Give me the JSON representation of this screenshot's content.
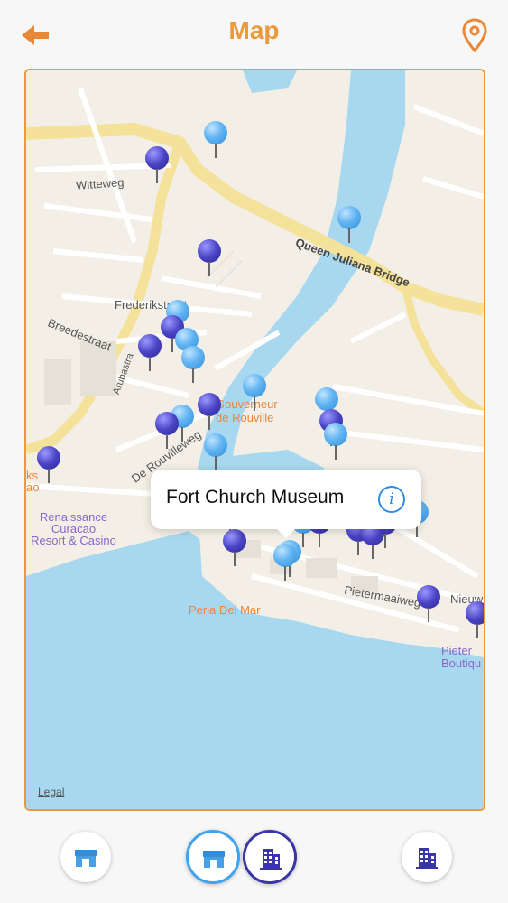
{
  "header": {
    "title": "Map",
    "back_icon": "back-arrow-icon",
    "location_icon": "location-pin-icon",
    "accent": "#e89a3c"
  },
  "map": {
    "streets": {
      "witteweg": "Witteweg",
      "queen_juliana": "Queen Juliana Bridge",
      "frederikstraat": "Frederikstraat",
      "breedestraat": "Breedestraat",
      "arubastraat": "Arubastra",
      "de_rouvilleweg": "De Rouvilleweg",
      "pietermaaiweg": "Pietermaaiweg",
      "nieuw": "Nieuw"
    },
    "pois": {
      "gouverneur": "Gouverneur\nde Rouville",
      "renaissance": "Renaissance\nCuracao\nResort & Casino",
      "peria": "Peria Del Mar",
      "pieter": "Pieter\nBoutiqu",
      "ksao": "ks\nao"
    },
    "callout": {
      "title": "Fort Church Museum",
      "info_icon": "info-icon"
    },
    "legal": "Legal",
    "pin_colors": {
      "light": "#4aa8ee",
      "dark": "#3a35b0"
    }
  },
  "filters": [
    {
      "name": "shop-filter-button",
      "icon": "shop-icon"
    },
    {
      "name": "shop-filter-button-active",
      "icon": "shop-icon"
    },
    {
      "name": "building-filter-button-active",
      "icon": "building-icon"
    },
    {
      "name": "building-filter-button",
      "icon": "building-icon"
    }
  ]
}
